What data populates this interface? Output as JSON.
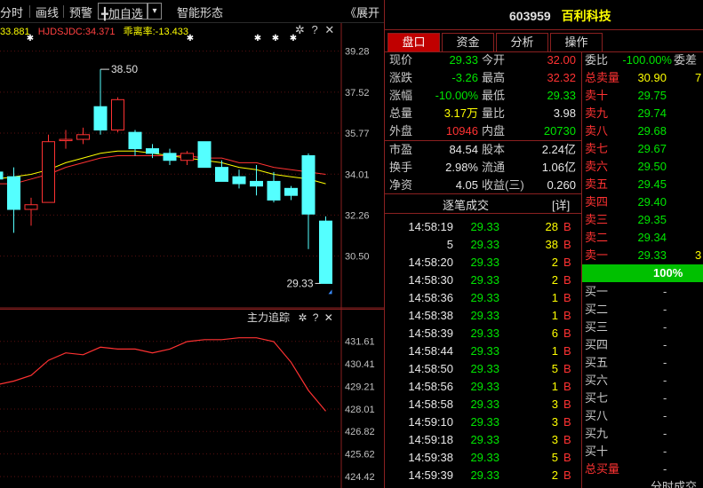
{
  "toolbar": {
    "items": [
      "分时",
      "画线",
      "预警",
      "╋加自选",
      "智能形态",
      "《展开"
    ],
    "dropdown": "▾"
  },
  "main_chart": {
    "indicator_values": [
      {
        "text": "33.881",
        "color": "#ffff00"
      },
      {
        "text": "HJDSJDC:34.371",
        "color": "#ff4040"
      },
      {
        "text": "乖离率:-13.433",
        "color": "#ffff00"
      }
    ],
    "y_ticks": [
      "39.28",
      "37.52",
      "35.77",
      "34.01",
      "32.26",
      "30.50"
    ],
    "high_label": "38.50",
    "low_label": "29.33"
  },
  "sub_chart": {
    "title": "主力追踪",
    "y_ticks": [
      "431.61",
      "430.41",
      "429.21",
      "428.01",
      "426.82",
      "425.62",
      "424.42"
    ]
  },
  "chart_icons": [
    "gear-icon",
    "help-icon",
    "close-icon"
  ],
  "chart_data": [
    {
      "type": "candlestick",
      "ylim": [
        28.7,
        40.1
      ],
      "y_ticks": [
        39.28,
        37.52,
        35.77,
        34.01,
        32.26,
        30.5
      ],
      "candles": [
        {
          "o": 34.1,
          "h": 34.4,
          "c": 33.8,
          "l": 33.6
        },
        {
          "o": 33.9,
          "h": 34.3,
          "c": 32.5,
          "l": 31.5
        },
        {
          "o": 32.5,
          "h": 33.0,
          "c": 32.7,
          "l": 31.8
        },
        {
          "o": 32.8,
          "h": 35.7,
          "c": 35.4,
          "l": 32.8
        },
        {
          "o": 35.5,
          "h": 35.9,
          "c": 35.5,
          "l": 35.1
        },
        {
          "o": 35.5,
          "h": 36.0,
          "c": 35.7,
          "l": 35.3
        },
        {
          "o": 36.9,
          "h": 38.5,
          "c": 35.9,
          "l": 35.7
        },
        {
          "o": 35.9,
          "h": 37.3,
          "c": 37.2,
          "l": 35.8
        },
        {
          "o": 35.8,
          "h": 35.9,
          "c": 35.1,
          "l": 34.8
        },
        {
          "o": 35.1,
          "h": 35.3,
          "c": 34.9,
          "l": 34.7
        },
        {
          "o": 34.9,
          "h": 35.1,
          "c": 34.6,
          "l": 34.4
        },
        {
          "o": 34.6,
          "h": 35.0,
          "c": 34.9,
          "l": 34.4
        },
        {
          "o": 35.4,
          "h": 35.4,
          "c": 34.3,
          "l": 34.3
        },
        {
          "o": 34.3,
          "h": 34.6,
          "c": 33.7,
          "l": 33.7
        },
        {
          "o": 33.9,
          "h": 34.2,
          "c": 33.6,
          "l": 33.4
        },
        {
          "o": 33.7,
          "h": 34.4,
          "c": 33.5,
          "l": 33.1
        },
        {
          "o": 33.7,
          "h": 34.1,
          "c": 32.9,
          "l": 32.8
        },
        {
          "o": 33.4,
          "h": 33.5,
          "c": 33.1,
          "l": 32.9
        },
        {
          "o": 34.8,
          "h": 34.9,
          "c": 32.3,
          "l": 30.8
        },
        {
          "o": 32.0,
          "h": 32.2,
          "c": 29.33,
          "l": 29.33
        }
      ],
      "ma_yellow": [
        33.8,
        33.9,
        34.0,
        34.2,
        34.5,
        34.7,
        34.9,
        35.0,
        35.0,
        34.9,
        34.8,
        34.7,
        34.6,
        34.5,
        34.3,
        34.2,
        34.0,
        33.9,
        33.8,
        33.6
      ],
      "ma_red": [
        33.6,
        33.6,
        33.8,
        34.0,
        34.3,
        34.5,
        34.7,
        34.8,
        34.8,
        34.8,
        34.8,
        34.8,
        34.7,
        34.7,
        34.5,
        34.5,
        34.3,
        34.2,
        34.1,
        34.0
      ]
    },
    {
      "type": "line",
      "title": "主力追踪",
      "ylim": [
        424.0,
        432.4
      ],
      "y_ticks": [
        431.61,
        430.41,
        429.21,
        428.01,
        426.82,
        425.62,
        424.42
      ],
      "values": [
        429.3,
        429.5,
        429.8,
        430.6,
        431.0,
        430.9,
        431.3,
        431.2,
        431.2,
        431.0,
        431.2,
        431.6,
        431.7,
        431.7,
        431.8,
        431.8,
        431.6,
        430.5,
        429.0,
        427.9
      ]
    }
  ],
  "stock": {
    "code": "603959",
    "name": "百利科技"
  },
  "tabs": [
    "盘口",
    "资金",
    "分析",
    "操作"
  ],
  "quote": [
    {
      "l1": "现价",
      "v1": "29.33",
      "c1": "#00e600",
      "l2": "今开",
      "v2": "32.00",
      "c2": "#ff3232"
    },
    {
      "l1": "涨跌",
      "v1": "-3.26",
      "c1": "#00e600",
      "l2": "最高",
      "v2": "32.32",
      "c2": "#ff3232"
    },
    {
      "l1": "涨幅",
      "v1": "-10.00%",
      "c1": "#00e600",
      "l2": "最低",
      "v2": "29.33",
      "c2": "#00e600"
    },
    {
      "l1": "总量",
      "v1": "3.17万",
      "c1": "#ffff00",
      "l2": "量比",
      "v2": "3.98",
      "c2": "#e8e8e8"
    },
    {
      "l1": "外盘",
      "v1": "10946",
      "c1": "#ff3232",
      "l2": "内盘",
      "v2": "20730",
      "c2": "#00e600"
    }
  ],
  "fundamentals": [
    {
      "l1": "市盈",
      "v1": "84.54",
      "l2": "股本",
      "v2": "2.24亿"
    },
    {
      "l1": "换手",
      "v1": "2.98%",
      "l2": "流通",
      "v2": "1.06亿"
    },
    {
      "l1": "净资",
      "v1": "4.05",
      "l2": "收益(三)",
      "v2": "0.260"
    }
  ],
  "ticks_header": {
    "title": "逐笔成交",
    "detail": "[详]"
  },
  "ticks": [
    {
      "time": "14:58:19",
      "price": "29.33",
      "vol": "28",
      "side": "B"
    },
    {
      "time": "5",
      "price": "29.33",
      "vol": "38",
      "side": "B"
    },
    {
      "time": "14:58:20",
      "price": "29.33",
      "vol": "2",
      "side": "B"
    },
    {
      "time": "14:58:30",
      "price": "29.33",
      "vol": "2",
      "side": "B"
    },
    {
      "time": "14:58:36",
      "price": "29.33",
      "vol": "1",
      "side": "B"
    },
    {
      "time": "14:58:38",
      "price": "29.33",
      "vol": "1",
      "side": "B"
    },
    {
      "time": "14:58:39",
      "price": "29.33",
      "vol": "6",
      "side": "B"
    },
    {
      "time": "14:58:44",
      "price": "29.33",
      "vol": "1",
      "side": "B"
    },
    {
      "time": "14:58:50",
      "price": "29.33",
      "vol": "5",
      "side": "B"
    },
    {
      "time": "14:58:56",
      "price": "29.33",
      "vol": "1",
      "side": "B"
    },
    {
      "time": "14:58:58",
      "price": "29.33",
      "vol": "3",
      "side": "B"
    },
    {
      "time": "14:59:10",
      "price": "29.33",
      "vol": "3",
      "side": "B"
    },
    {
      "time": "14:59:18",
      "price": "29.33",
      "vol": "3",
      "side": "B"
    },
    {
      "time": "14:59:38",
      "price": "29.33",
      "vol": "5",
      "side": "B"
    },
    {
      "time": "14:59:39",
      "price": "29.33",
      "vol": "2",
      "side": "B"
    }
  ],
  "order_book": {
    "wei_bi_label": "委比",
    "wei_bi_value": "-100.00%",
    "wei_cha_label": "委差",
    "wei_cha_value": "7",
    "total_sell_label": "总卖量",
    "total_sell_value": "30.90",
    "total_sell_extra": "7",
    "sells": [
      {
        "label": "卖十",
        "price": "29.75",
        "vol": ""
      },
      {
        "label": "卖九",
        "price": "29.74",
        "vol": ""
      },
      {
        "label": "卖八",
        "price": "29.68",
        "vol": ""
      },
      {
        "label": "卖七",
        "price": "29.67",
        "vol": ""
      },
      {
        "label": "卖六",
        "price": "29.50",
        "vol": ""
      },
      {
        "label": "卖五",
        "price": "29.45",
        "vol": ""
      },
      {
        "label": "卖四",
        "price": "29.40",
        "vol": ""
      },
      {
        "label": "卖三",
        "price": "29.35",
        "vol": ""
      },
      {
        "label": "卖二",
        "price": "29.34",
        "vol": ""
      },
      {
        "label": "卖一",
        "price": "29.33",
        "vol": "3"
      }
    ],
    "sell_ratio": "100%",
    "buys": [
      {
        "label": "买一",
        "value": "-"
      },
      {
        "label": "买二",
        "value": "-"
      },
      {
        "label": "买三",
        "value": "-"
      },
      {
        "label": "买四",
        "value": "-"
      },
      {
        "label": "买五",
        "value": "-"
      },
      {
        "label": "买六",
        "value": "-"
      },
      {
        "label": "买七",
        "value": "-"
      },
      {
        "label": "买八",
        "value": "-"
      },
      {
        "label": "买九",
        "value": "-"
      },
      {
        "label": "买十",
        "value": "-"
      }
    ],
    "total_buy_label": "总买量",
    "total_buy_value": "-",
    "footer": "分时成交"
  }
}
